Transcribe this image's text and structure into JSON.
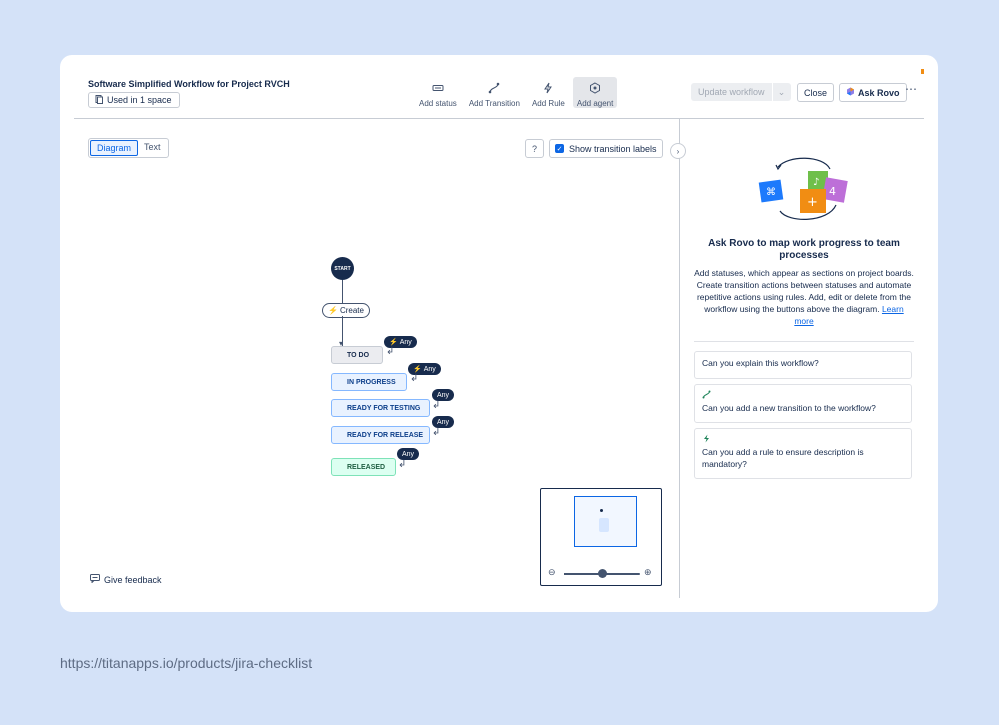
{
  "header": {
    "title": "Software Simplified Workflow for Project RVCH",
    "used_badge": "Used in 1 space",
    "toolbar": [
      {
        "label": "Add status",
        "icon": "status-icon"
      },
      {
        "label": "Add Transition",
        "icon": "transition-icon"
      },
      {
        "label": "Add Rule",
        "icon": "bolt-icon"
      },
      {
        "label": "Add agent",
        "icon": "agent-icon"
      }
    ],
    "update_label": "Update workflow",
    "close_label": "Close",
    "ask_rovo_label": "Ask Rovo",
    "more_label": "⋯"
  },
  "view": {
    "tabs": [
      "Diagram",
      "Text"
    ],
    "selected_tab": "Diagram",
    "help_label": "?",
    "show_labels": "Show transition labels",
    "show_labels_checked": true
  },
  "diagram": {
    "start": "START",
    "create": "Create",
    "any": "Any",
    "statuses": [
      "TO DO",
      "IN PROGRESS",
      "READY FOR TESTING",
      "READY FOR RELEASE",
      "RELEASED"
    ]
  },
  "minimap": {
    "zoom_level": 0.5
  },
  "feedback_label": "Give feedback",
  "panel": {
    "title": "Ask Rovo to map work progress to team processes",
    "description": "Add statuses, which appear as sections on project boards. Create transition actions between statuses and automate repetitive actions using rules. Add, edit or delete from the workflow using the buttons above the diagram.",
    "learn_more": "Learn more",
    "prompts": [
      {
        "icon": "",
        "text": "Can you explain this workflow?"
      },
      {
        "icon": "transition-icon",
        "text": "Can you add a new transition to the workflow?"
      },
      {
        "icon": "bolt-icon",
        "text": "Can you add a rule to ensure description is mandatory?"
      }
    ]
  },
  "footer_url": "https://titanapps.io/products/jira-checklist",
  "colors": {
    "background": "#d4e2f8",
    "accent": "#0c66e4",
    "in_progress": "#e9f2ff",
    "done": "#dcfff1",
    "dark": "#172b4d"
  }
}
